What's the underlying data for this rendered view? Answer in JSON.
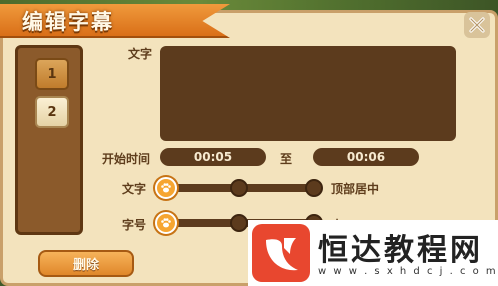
{
  "dialog": {
    "title": "编辑字幕",
    "close_icon": "close-x-icon"
  },
  "sidebar": {
    "items": [
      {
        "label": "1"
      },
      {
        "label": "2"
      }
    ]
  },
  "editor": {
    "text_label": "文字",
    "text_value": "",
    "start_time_label": "开始时间",
    "start_time": "00:05",
    "to_label": "至",
    "end_time": "00:06",
    "position_label": "文字",
    "position_value": "顶部居中",
    "size_label": "字号",
    "size_value_partial": "小"
  },
  "actions": {
    "delete_label": "删除"
  },
  "watermark": {
    "name": "恒达教程网",
    "url": "w w w . s x h d c j . c o m"
  },
  "colors": {
    "panel_bg": "#f3e3bd",
    "dark_brown": "#5c3b1d",
    "accent_orange": "#f09a3c",
    "watermark_red": "#e8472f"
  }
}
